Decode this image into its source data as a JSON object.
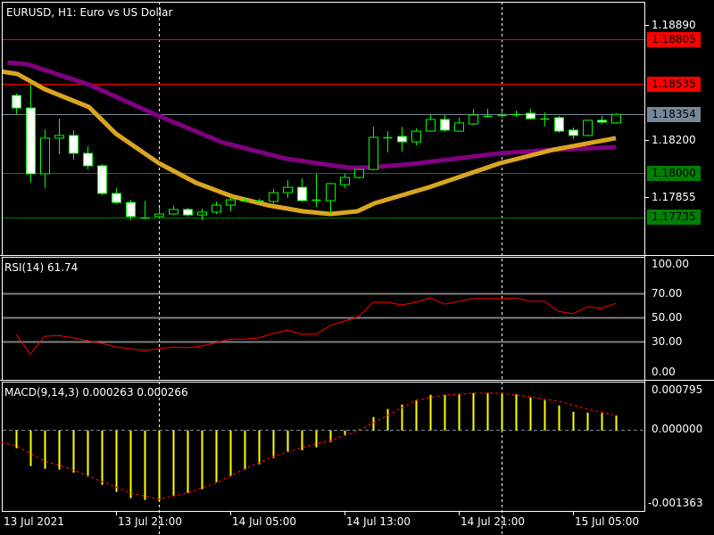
{
  "header": {
    "title": "EURUSD, H1:  Euro vs US Dollar"
  },
  "colors": {
    "bull_outline": "#00ff00",
    "bear_fill": "#ffffff",
    "ma_fast": "#daa520",
    "ma_slow": "#800080",
    "rsi": "#ff0000",
    "macd_hist": "#ffff00",
    "macd_signal": "#ff0000",
    "resistance": "#ff0000",
    "support": "#008000",
    "bid": "#778899"
  },
  "price_axis": {
    "labels": [
      "1.18890",
      "1.18200",
      "1.17855"
    ]
  },
  "levels": [
    {
      "price": 1.18805,
      "label": "1.18805",
      "type": "resistance"
    },
    {
      "price": 1.18535,
      "label": "1.18535",
      "type": "resistance"
    },
    {
      "price": 1.18354,
      "label": "1.18354",
      "type": "bid"
    },
    {
      "price": 1.18,
      "label": "1.18000",
      "type": "support"
    },
    {
      "price": 1.17735,
      "label": "1.17735",
      "type": "support"
    }
  ],
  "chart_data": [
    {
      "type": "candlestick",
      "symbol": "EURUSD",
      "timeframe": "H1",
      "ylim": [
        1.1762,
        1.1894
      ],
      "candles_ohlc": [
        [
          1.18467,
          1.18478,
          1.18355,
          1.18392
        ],
        [
          1.18392,
          1.18532,
          1.17943,
          1.17997
        ],
        [
          1.17997,
          1.18264,
          1.17911,
          1.18211
        ],
        [
          1.18211,
          1.18328,
          1.18114,
          1.18227
        ],
        [
          1.18227,
          1.18259,
          1.18082,
          1.1812
        ],
        [
          1.1812,
          1.18162,
          1.18023,
          1.18045
        ],
        [
          1.18045,
          1.18055,
          1.17868,
          1.17879
        ],
        [
          1.17879,
          1.17911,
          1.17815,
          1.17825
        ],
        [
          1.17825,
          1.17841,
          1.17718,
          1.1774
        ],
        [
          1.17734,
          1.17836,
          1.17729,
          1.17735
        ],
        [
          1.1774,
          1.17793,
          1.17729,
          1.17756
        ],
        [
          1.17756,
          1.17804,
          1.1775,
          1.17783
        ],
        [
          1.17783,
          1.17793,
          1.1774,
          1.1775
        ],
        [
          1.1775,
          1.17788,
          1.17718,
          1.17767
        ],
        [
          1.17767,
          1.17831,
          1.17756,
          1.17809
        ],
        [
          1.17809,
          1.17857,
          1.17772,
          1.17841
        ],
        [
          1.17836,
          1.17852,
          1.17831,
          1.17841
        ],
        [
          1.17836,
          1.17847,
          1.1782,
          1.17838
        ],
        [
          1.17831,
          1.17906,
          1.1782,
          1.17884
        ],
        [
          1.17884,
          1.17959,
          1.17852,
          1.17916
        ],
        [
          1.17916,
          1.1797,
          1.17831,
          1.17836
        ],
        [
          1.17841,
          1.17997,
          1.17799,
          1.17843
        ],
        [
          1.17836,
          1.17943,
          1.17756,
          1.17938
        ],
        [
          1.17932,
          1.17997,
          1.17911,
          1.17975
        ],
        [
          1.17975,
          1.18023,
          1.1797,
          1.18023
        ],
        [
          1.18023,
          1.1828,
          1.18018,
          1.18216
        ],
        [
          1.18216,
          1.18253,
          1.18125,
          1.18218
        ],
        [
          1.18221,
          1.1828,
          1.1813,
          1.18189
        ],
        [
          1.18189,
          1.18269,
          1.18168,
          1.18253
        ],
        [
          1.18253,
          1.1835,
          1.18248,
          1.18323
        ],
        [
          1.18323,
          1.1835,
          1.18248,
          1.18259
        ],
        [
          1.18253,
          1.18334,
          1.18248,
          1.18302
        ],
        [
          1.18296,
          1.18387,
          1.18291,
          1.1835
        ],
        [
          1.18344,
          1.18387,
          1.18334,
          1.18346
        ],
        [
          1.1835,
          1.18376,
          1.18334,
          1.18351
        ],
        [
          1.18355,
          1.18376,
          1.18339,
          1.18354
        ],
        [
          1.1836,
          1.18387,
          1.18323,
          1.18328
        ],
        [
          1.18328,
          1.18366,
          1.1828,
          1.18327
        ],
        [
          1.18334,
          1.18344,
          1.18243,
          1.18253
        ],
        [
          1.18259,
          1.18275,
          1.18205,
          1.18227
        ],
        [
          1.18227,
          1.18323,
          1.18221,
          1.18318
        ],
        [
          1.18318,
          1.18344,
          1.18296,
          1.18307
        ],
        [
          1.18302,
          1.1836,
          1.18296,
          1.18354
        ]
      ],
      "ma_slow": [
        [
          -0.6,
          1.18665
        ],
        [
          0.75,
          1.18655
        ],
        [
          5.1,
          1.18532
        ],
        [
          10,
          1.18344
        ],
        [
          14.5,
          1.18184
        ],
        [
          18.9,
          1.18088
        ],
        [
          23.25,
          1.18034
        ],
        [
          24.5,
          1.18034
        ],
        [
          27.6,
          1.18055
        ],
        [
          33.9,
          1.1812
        ],
        [
          37.6,
          1.18141
        ],
        [
          42,
          1.18157
        ]
      ],
      "ma_fast": [
        [
          -1.1,
          1.18612
        ],
        [
          0.1,
          1.18596
        ],
        [
          2,
          1.18505
        ],
        [
          5.1,
          1.18398
        ],
        [
          7,
          1.18237
        ],
        [
          10,
          1.18061
        ],
        [
          12.6,
          1.17943
        ],
        [
          15.1,
          1.17863
        ],
        [
          17.6,
          1.17809
        ],
        [
          20.1,
          1.17772
        ],
        [
          22,
          1.17756
        ],
        [
          23.9,
          1.17772
        ],
        [
          25.1,
          1.1782
        ],
        [
          28.9,
          1.17916
        ],
        [
          33.9,
          1.18061
        ],
        [
          37.6,
          1.18141
        ],
        [
          42,
          1.18211
        ]
      ]
    },
    {
      "type": "line",
      "title": "RSI(14) 61.74",
      "ylim": [
        0,
        100
      ],
      "levels": [
        70,
        50,
        30
      ],
      "tick_labels": [
        "100.00",
        "70.00",
        "50.00",
        "30.00",
        "0.00"
      ],
      "values": [
        36,
        19.5,
        34.4,
        35,
        33,
        30.7,
        28.5,
        25.5,
        24,
        22.6,
        24,
        25.5,
        24.8,
        26.3,
        29,
        32,
        32,
        33,
        36.7,
        39.6,
        36,
        36,
        43.3,
        47,
        50.7,
        62.6,
        62.6,
        60.4,
        62.6,
        66.3,
        61,
        63.3,
        65.6,
        65.6,
        65.6,
        66.3,
        63.3,
        63.3,
        55,
        53,
        59,
        57.4,
        61.74
      ]
    },
    {
      "type": "bar",
      "title": "MACD(9,14,3) 0.000263 0.000266",
      "ylim": [
        -0.001363,
        0.000795
      ],
      "tick_labels": [
        "0.000795",
        "0.000000",
        "-0.001363"
      ],
      "histogram": [
        -0.000311,
        -0.000624,
        -0.000671,
        -0.000686,
        -0.000738,
        -0.000811,
        -0.000952,
        -0.001077,
        -0.001187,
        -0.001218,
        -0.001234,
        -0.001156,
        -0.001093,
        -0.00103,
        -0.000905,
        -0.000796,
        -0.000686,
        -0.000593,
        -0.000483,
        -0.000374,
        -0.000347,
        -0.000295,
        -0.000202,
        -9.2e-05,
        2e-05,
        0.000236,
        0.000377,
        0.000455,
        0.000533,
        0.000627,
        0.000627,
        0.000643,
        0.000658,
        0.000658,
        0.000658,
        0.000633,
        0.00058,
        0.000533,
        0.000439,
        0.00033,
        0.000314,
        0.000305,
        0.000263
      ],
      "signal": [
        [
          -1,
          -0.000206
        ],
        [
          0,
          -0.000269
        ],
        [
          2,
          -0.000535
        ],
        [
          4,
          -0.00069
        ],
        [
          6,
          -0.000894
        ],
        [
          8,
          -0.001097
        ],
        [
          10,
          -0.001203
        ],
        [
          12,
          -0.001097
        ],
        [
          14,
          -0.000921
        ],
        [
          16,
          -0.000675
        ],
        [
          18,
          -0.000457
        ],
        [
          20,
          -0.0003
        ],
        [
          22,
          -0.000175
        ],
        [
          24,
          0
        ],
        [
          26,
          0.000263
        ],
        [
          28,
          0.000529
        ],
        [
          30,
          0.000622
        ],
        [
          32,
          0.000654
        ],
        [
          34,
          0.000654
        ],
        [
          36,
          0.000591
        ],
        [
          38,
          0.000513
        ],
        [
          40,
          0.000372
        ],
        [
          42,
          0.000266
        ]
      ]
    }
  ],
  "time_axis": {
    "labels": [
      {
        "text": "13 Jul 2021",
        "bar": -1
      },
      {
        "text": "13 Jul 21:00",
        "bar": 7
      },
      {
        "text": "14 Jul 05:00",
        "bar": 15
      },
      {
        "text": "14 Jul 13:00",
        "bar": 23
      },
      {
        "text": "14 Jul 21:00",
        "bar": 31
      },
      {
        "text": "15 Jul 05:00",
        "bar": 39
      }
    ],
    "day_separators": [
      10,
      34
    ]
  }
}
